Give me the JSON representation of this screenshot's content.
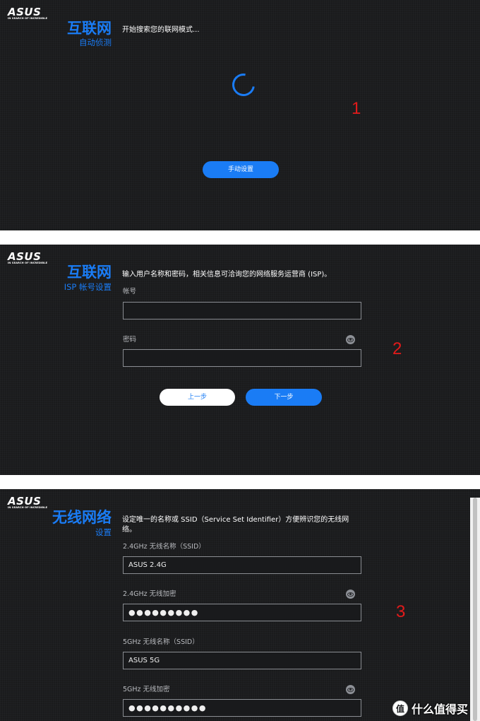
{
  "brand": {
    "logo": "ASUS",
    "tagline": "IN SEARCH OF INCREDIBLE"
  },
  "colors": {
    "accent": "#1a7cf5",
    "panel_bg": "#1c1d1f",
    "step_marker": "#e21a1a"
  },
  "step1": {
    "title": "互联网",
    "subtitle": "自动侦测",
    "description": "开始搜索您的联网模式...",
    "manual_button": "手动设置",
    "marker": "1"
  },
  "step2": {
    "title": "互联网",
    "subtitle": "ISP 帐号设置",
    "description": "输入用户名称和密码，相关信息可洽询您的网络服务运营商 (ISP)。",
    "username_label": "帐号",
    "username_value": "",
    "password_label": "密码",
    "password_value": "",
    "back_button": "上一步",
    "next_button": "下一步",
    "marker": "2"
  },
  "step3": {
    "title": "无线网络",
    "subtitle": "设置",
    "description": "设定唯一的名称或 SSID（Service Set Identifier）方便辨识您的无线网络。",
    "ssid_24_label": "2.4GHz 无线名称（SSID）",
    "ssid_24_value": "ASUS 2.4G",
    "key_24_label": "2.4GHz 无线加密",
    "key_24_value": "●●●●●●●●●",
    "ssid_5_label": "5GHz 无线名称（SSID）",
    "ssid_5_value": "ASUS 5G",
    "key_5_label": "5GHz 无线加密",
    "key_5_value": "●●●●●●●●●●",
    "marker": "3"
  },
  "watermark": {
    "icon": "值",
    "text": "什么值得买"
  }
}
